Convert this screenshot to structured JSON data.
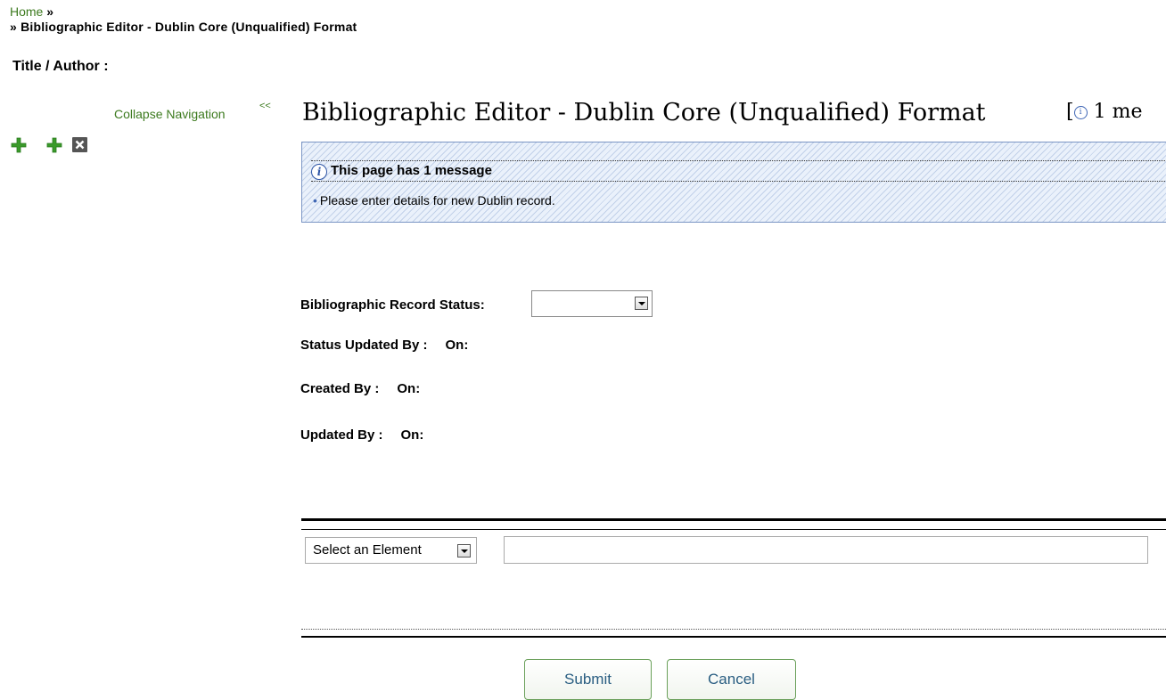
{
  "breadcrumb": {
    "home": "Home",
    "home_sep": "»",
    "current_prefix": "»",
    "current": "Bibliographic Editor - Dublin Core (Unqualified) Format"
  },
  "title_author": "Title / Author :",
  "nav": {
    "collapse_label": "Collapse Navigation",
    "collapse_arrows": "<<",
    "icons": [
      "add-icon",
      "add-icon",
      "close-icon"
    ]
  },
  "page": {
    "heading": "Bibliographic Editor - Dublin Core (Unqualified) Format",
    "message_count": "1 me",
    "message_count_bracket": "["
  },
  "messages": {
    "header": "This page has 1 message",
    "items": [
      "Please enter details for new Dublin record."
    ]
  },
  "record": {
    "status_label": "Bibliographic Record Status:",
    "status_value": "",
    "status_updated_by_label": "Status Updated By :",
    "on_label": "On:",
    "created_by_label": "Created By :",
    "updated_by_label": "Updated By :"
  },
  "element_editor": {
    "select_label": "Select an Element",
    "value": ""
  },
  "actions": {
    "submit": "Submit",
    "cancel": "Cancel"
  },
  "colors": {
    "link_green": "#3c7a1e",
    "icon_green": "#3a9a2a",
    "message_blue": "#3f66b5"
  }
}
